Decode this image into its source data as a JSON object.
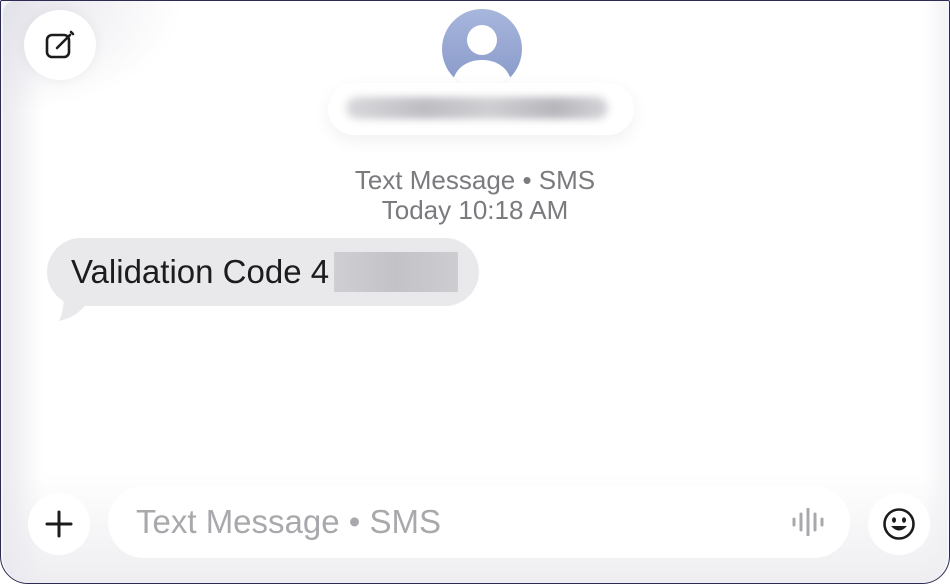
{
  "header": {
    "compose_icon": "compose-icon",
    "avatar_icon": "person-silhouette-icon"
  },
  "conversation": {
    "service_label": "Text Message • SMS",
    "timestamp": "Today 10:18 AM",
    "messages": [
      {
        "direction": "incoming",
        "text": "Validation Code 4"
      }
    ]
  },
  "composer": {
    "add_icon": "plus-icon",
    "placeholder": "Text Message • SMS",
    "value": "",
    "voice_icon": "waveform-icon",
    "emoji_icon": "smiley-face-icon"
  },
  "colors": {
    "incoming_bubble": "#e9e9eb",
    "meta_text": "#7a7a7f",
    "placeholder_text": "#a9a9ad",
    "avatar_top": "#a7b6dc",
    "avatar_bottom": "#8898c8",
    "window_border": "#2b2b55"
  }
}
